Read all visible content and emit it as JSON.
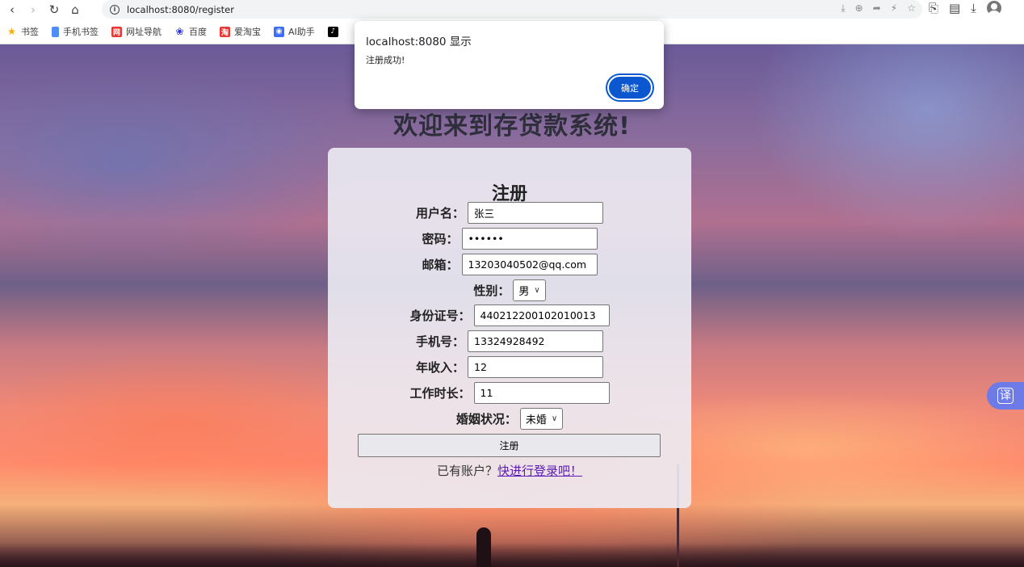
{
  "browser": {
    "url": "localhost:8080/register",
    "bookmarks": [
      {
        "label": "书签",
        "icon": "star-icon",
        "color": "#f9ab00"
      },
      {
        "label": "手机书签",
        "icon": "bookmark-folder-icon",
        "color": "#4f8df7"
      },
      {
        "label": "网址导航",
        "icon": "nav-site-icon",
        "color": "#e53935"
      },
      {
        "label": "百度",
        "icon": "baidu-icon",
        "color": "#2932e1"
      },
      {
        "label": "爱淘宝",
        "icon": "taobao-icon",
        "color": "#e53935"
      },
      {
        "label": "AI助手",
        "icon": "ai-assistant-icon",
        "color": "#3f6ff5"
      },
      {
        "label": "",
        "icon": "tiktok-icon",
        "color": "#000000"
      }
    ]
  },
  "page": {
    "welcome": "欢迎来到存贷款系统!",
    "form": {
      "title": "注册",
      "username_label": "用户名：",
      "username": "张三",
      "password_label": "密码：",
      "password": "••••••",
      "email_label": "邮箱：",
      "email": "13203040502@qq.com",
      "gender_label": "性别：",
      "gender": "男",
      "id_label": "身份证号：",
      "id_number": "440212200102010013",
      "phone_label": "手机号：",
      "phone": "13324928492",
      "income_label": "年收入：",
      "income": "12",
      "work_label": "工作时长：",
      "work_years": "11",
      "marital_label": "婚姻状况：",
      "marital": "未婚",
      "submit": "注册",
      "footer_text": "已有账户？",
      "footer_link": "快进行登录吧！"
    },
    "translate": "译"
  },
  "dialog": {
    "title": "localhost:8080 显示",
    "message": "注册成功!",
    "ok": "确定"
  }
}
